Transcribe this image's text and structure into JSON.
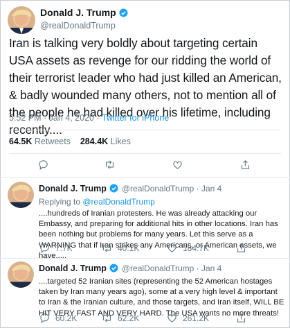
{
  "main_tweet": {
    "name": "Donald J. Trump",
    "handle": "@realDonaldTrump",
    "text": "Iran is talking very boldly about targeting certain USA assets as revenge for our ridding the world of their terrorist leader who had just killed an American, & badly wounded many others, not to mention all of the people he had killed over his lifetime, including recently....",
    "time": "5:52 PM · Jan 4, 2020 · ",
    "source": "Twitter for iPhone",
    "retweets_count": "64.5K",
    "retweets_label": "Retweets",
    "likes_count": "284.4K",
    "likes_label": "Likes"
  },
  "replies": [
    {
      "name": "Donald J. Trump",
      "handle_date": "@realDonaldTrump · Jan 4",
      "replying_prefix": "Replying to ",
      "replying_to": "@realDonaldTrump",
      "text": "....hundreds of Iranian protesters. He was already attacking our Embassy, and preparing for additional hits in other locations. Iran has been nothing but problems for many years. Let this serve as a WARNING that if Iran strikes any Americans, or American assets, we have.....",
      "replies": "7.7K",
      "retweets": "40.1K",
      "likes": "184.7K"
    },
    {
      "name": "Donald J. Trump",
      "handle_date": "@realDonaldTrump · Jan 4",
      "text": "....targeted 52 Iranian sites (representing the 52 American hostages taken by Iran many years ago), some at a very high level & important to Iran & the Iranian culture, and those targets, and Iran itself, WILL BE HIT VERY FAST AND VERY HARD. The USA wants no more threats!",
      "replies": "60.2K",
      "retweets": "62.2K",
      "likes": "261.2K"
    }
  ],
  "colors": {
    "accent": "#1b95e0",
    "muted": "#657786",
    "text": "#14171a"
  },
  "icons": [
    "reply-icon",
    "retweet-icon",
    "like-icon",
    "share-icon",
    "verified-icon"
  ]
}
